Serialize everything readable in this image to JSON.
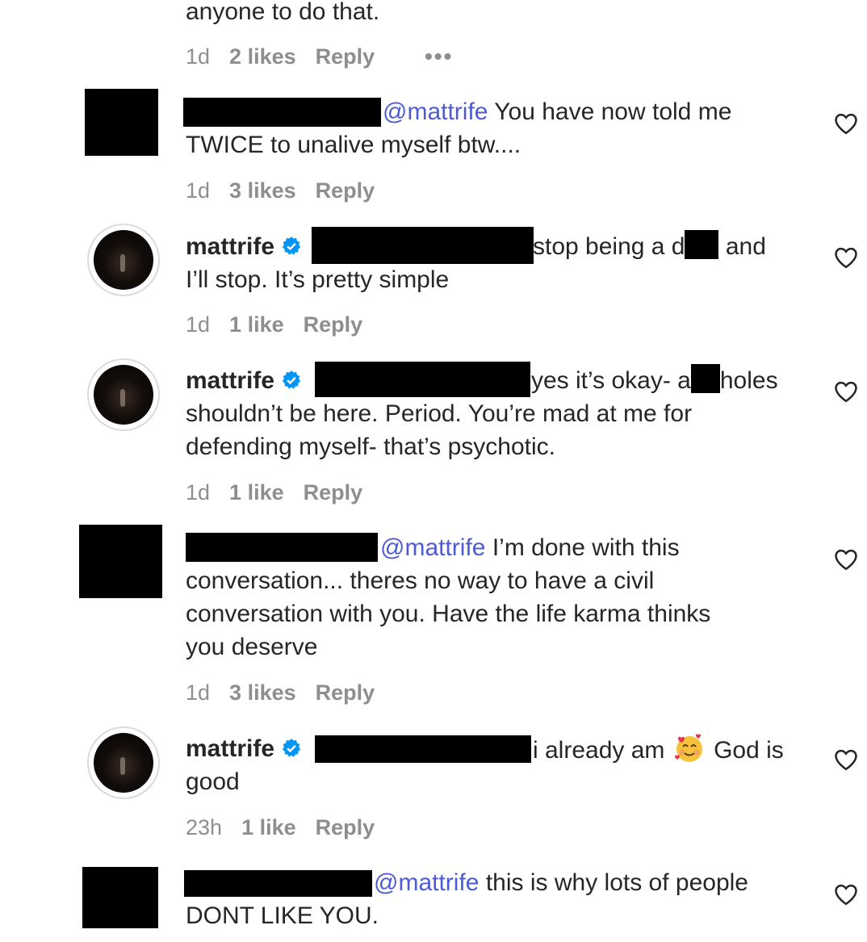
{
  "comments": [
    {
      "lines": [
        "anyone to do that."
      ],
      "time": "1d",
      "likes": "2 likes",
      "reply": "Reply",
      "more": "•••"
    },
    {
      "mention": "@mattrife",
      "line1_rest": " You have now told me",
      "line2": "TWICE to unalive myself btw....",
      "time": "1d",
      "likes": "3 likes",
      "reply": "Reply"
    },
    {
      "username": "mattrife",
      "line1_a": "stop being a d",
      "line1_b": " and",
      "line2": "I’ll stop. It’s pretty simple",
      "time": "1d",
      "likes": "1 like",
      "reply": "Reply"
    },
    {
      "username": "mattrife",
      "line1_a": "yes it’s okay- a",
      "line1_b": "holes",
      "line2": "shouldn’t be here. Period. You’re mad at me for",
      "line3": "defending myself- that’s psychotic.",
      "time": "1d",
      "likes": "1 like",
      "reply": "Reply"
    },
    {
      "mention": "@mattrife",
      "line1_rest": " I’m done with this",
      "line2": "conversation... theres no way to have a civil",
      "line3": "conversation with you. Have the life karma thinks",
      "line4": "you deserve",
      "time": "1d",
      "likes": "3 likes",
      "reply": "Reply"
    },
    {
      "username": "mattrife",
      "line1_a": "i already am",
      "line1_b": " God is",
      "line2": "good",
      "time": "23h",
      "likes": "1 like",
      "reply": "Reply"
    },
    {
      "mention": "@mattrife",
      "line1_rest": " this is why lots of people",
      "line2": "DONT LIKE YOU."
    }
  ],
  "icons": {
    "heart": "heart-outline-icon",
    "verified": "verified-badge-icon",
    "emoji": "smiling-face-with-hearts-emoji"
  },
  "colors": {
    "mention": "#4f5bd5",
    "meta": "#8e8e8e",
    "verified": "#0095f6"
  }
}
